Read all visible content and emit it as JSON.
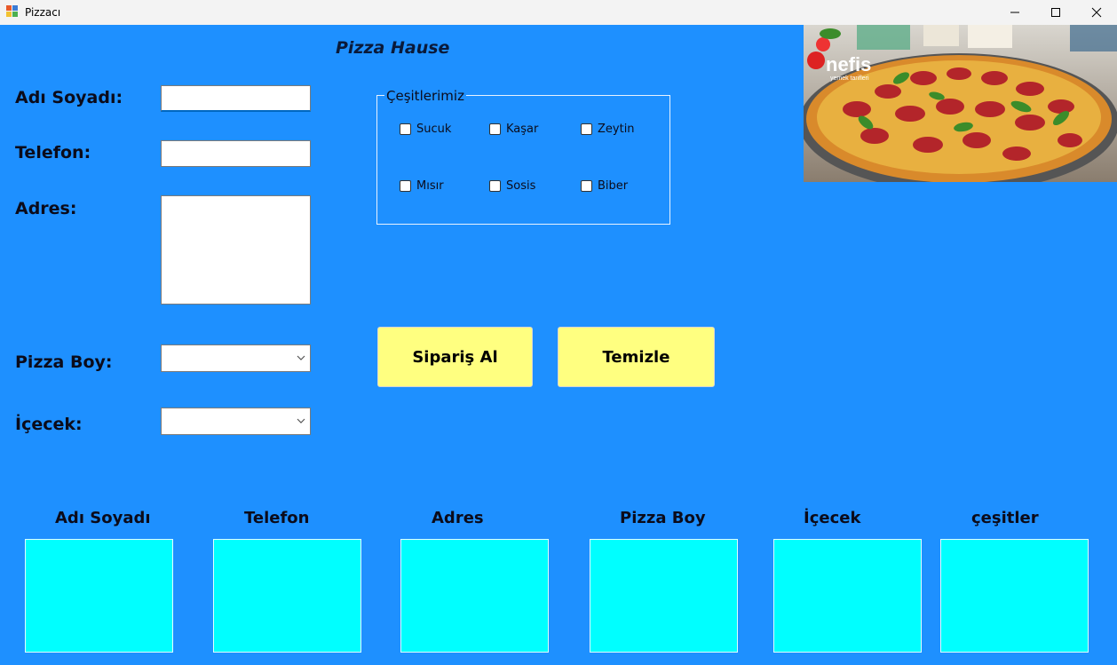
{
  "window": {
    "title": "Pizzacı"
  },
  "header": {
    "title": "Pizza Hause"
  },
  "form": {
    "name_label": "Adı Soyadı:",
    "phone_label": "Telefon:",
    "address_label": "Adres:",
    "size_label": "Pizza Boy:",
    "drink_label": "İçecek:"
  },
  "varieties": {
    "legend": "Çeşitlerimiz",
    "items": [
      "Sucuk",
      "Kaşar",
      "Zeytin",
      "Mısır",
      "Sosis",
      "Biber"
    ]
  },
  "buttons": {
    "order": "Sipariş Al",
    "clear": "Temizle"
  },
  "image": {
    "logo_text": "nefis",
    "logo_subtext": "yemek tarifleri"
  },
  "output": {
    "labels": [
      "Adı Soyadı",
      "Telefon",
      "Adres",
      "Pizza Boy",
      "İçecek",
      "çeşitler"
    ]
  },
  "colors": {
    "background": "#1e90ff",
    "button": "#ffff80",
    "output_box": "#00ffff"
  }
}
